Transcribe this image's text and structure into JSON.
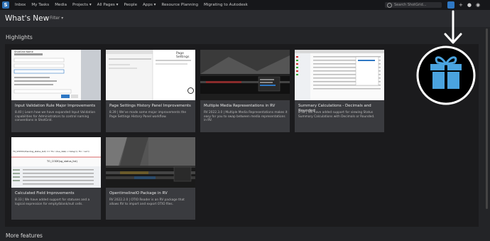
{
  "nav": {
    "items": [
      "Inbox",
      "My Tasks",
      "Media",
      "Projects ▾",
      "All Pages ▾",
      "People",
      "Apps ▾",
      "Resource Planning",
      "Migrating to Autodesk"
    ],
    "search_placeholder": "Search ShotGrid..."
  },
  "header": {
    "title": "What's New",
    "filter": "Filter ▾"
  },
  "highlights_label": "Highlights",
  "more_label": "More features",
  "cards": [
    {
      "title": "Input Validation Rule Major Improvements",
      "desc": "8.40 | Learn how we have expanded Input Validation capabilities for Administrators to control naming conventions in ShotGrid."
    },
    {
      "title": "Page Settings History Panel Improvements",
      "desc": "8.39 | We've made some major improvements the Page Settings History Panel workflow."
    },
    {
      "title": "Multiple Media Representations in RV",
      "desc": "RV 2022.3.0 | Multiple Media Representations makes it easy for you to swap between media representations in RV."
    },
    {
      "title": "Summary Calculations - Decimals and Rounded",
      "desc": "8.38 | We have added support for viewing Status Summary Calculations with Decimals or Rounded."
    },
    {
      "title": "Calculated Field Improvements",
      "desc": "8.33 | We have added support for statuses and a logical expression for empty/blank/null cells."
    },
    {
      "title": "OpentimelineIO Package in RV",
      "desc": "RV 2022.2.0 | OTIO Reader is an RV package that allows RV to import and export OTIO files."
    }
  ],
  "thumb_text": {
    "t1_heading": "ShotGrid Name",
    "t2_heading": "Page Settings",
    "t5_formula": "TO_STATUS(if(and(sg_status_list)) == 'fin', (due_date) < today()), 'fin', 'red'))",
    "t5_code": "TO_CODE(sg_status_list)"
  },
  "colors": {
    "accent": "#2f78c4",
    "gift": "#4aa3df"
  }
}
